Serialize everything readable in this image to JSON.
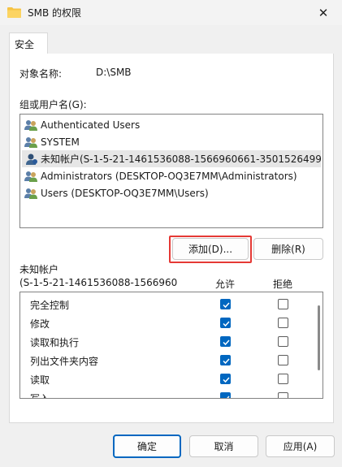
{
  "window": {
    "title": "SMB 的权限"
  },
  "tabs": [
    {
      "label": "安全"
    }
  ],
  "object": {
    "label": "对象名称:",
    "value": "D:\\SMB"
  },
  "groups": {
    "label": "组或用户名(G):",
    "items": [
      {
        "name": "Authenticated Users",
        "selected": false
      },
      {
        "name": "SYSTEM",
        "selected": false
      },
      {
        "name": "未知帐户(S-1-5-21-1461536088-1566960661-3501526499-...",
        "selected": true
      },
      {
        "name": "Administrators (DESKTOP-OQ3E7MM\\Administrators)",
        "selected": false
      },
      {
        "name": "Users (DESKTOP-OQ3E7MM\\Users)",
        "selected": false
      }
    ],
    "add_label": "添加(D)...",
    "remove_label": "删除(R)"
  },
  "permissions": {
    "for_label": "未知帐户",
    "sid_label": "(S-1-5-21-1461536088-1566960",
    "allow_header": "允许",
    "deny_header": "拒绝",
    "rows": [
      {
        "name": "完全控制",
        "allow": true,
        "deny": false
      },
      {
        "name": "修改",
        "allow": true,
        "deny": false
      },
      {
        "name": "读取和执行",
        "allow": true,
        "deny": false
      },
      {
        "name": "列出文件夹内容",
        "allow": true,
        "deny": false
      },
      {
        "name": "读取",
        "allow": true,
        "deny": false
      },
      {
        "name": "写入",
        "allow": true,
        "deny": false
      }
    ]
  },
  "footer": {
    "ok_label": "确定",
    "cancel_label": "取消",
    "apply_label": "应用(A)"
  },
  "colors": {
    "accent": "#0067c0",
    "highlight": "#e53935",
    "selected_row": "#e6e6e6"
  }
}
